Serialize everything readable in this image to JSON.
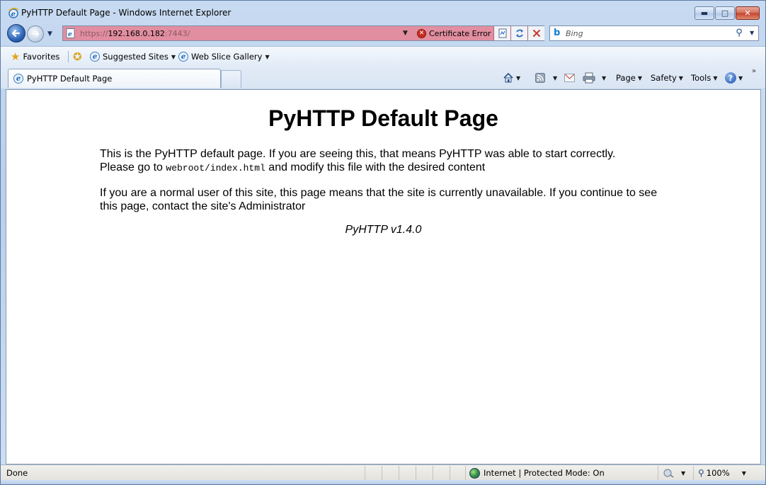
{
  "window": {
    "title": "PyHTTP Default Page - Windows Internet Explorer"
  },
  "address_bar": {
    "url_protocol": "https://",
    "url_host": "192.168.0.182",
    "url_port": ":7443/",
    "certificate_error_label": "Certificate Error"
  },
  "search": {
    "placeholder": "Bing"
  },
  "favorites_bar": {
    "favorites_label": "Favorites",
    "suggested_sites_label": "Suggested Sites",
    "web_slice_gallery_label": "Web Slice Gallery"
  },
  "tabs": [
    {
      "label": "PyHTTP Default Page"
    }
  ],
  "command_bar": {
    "page_label": "Page",
    "safety_label": "Safety",
    "tools_label": "Tools"
  },
  "page": {
    "heading": "PyHTTP Default Page",
    "para1_line1": "This is the PyHTTP default page. If you are seeing this, that means PyHTTP was able to start correctly.",
    "para1_line2_prefix": "Please go to ",
    "para1_code": "webroot/index.html",
    "para1_line2_suffix": " and modify this file with the desired content",
    "para2": "If you are a normal user of this site, this page means that the site is currently unavailable. If you continue to see this page, contact the site's Administrator",
    "version": "PyHTTP v1.4.0"
  },
  "status_bar": {
    "status_text": "Done",
    "zone_text": "Internet | Protected Mode: On",
    "zoom_text": "100%"
  }
}
